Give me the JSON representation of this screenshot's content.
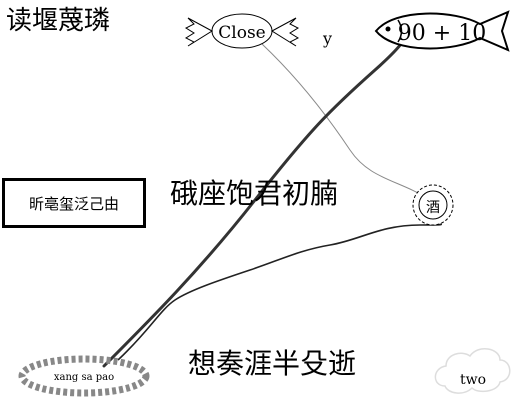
{
  "title_top_left": "读堰蔑璘",
  "candy_label": "Close",
  "candy_suffix": "y",
  "fish_label": "90 + 10",
  "box_label": "昕亳玺泛己由",
  "middle_text": "硪座饱君初腩",
  "seal_label": "酒",
  "bottom_text": "想奏涯半殳逝",
  "wreath_text": "xang sa pao",
  "cloud_label": "two",
  "colors": {
    "ink": "#000000",
    "line_gray": "#8a8a8a",
    "dark_line": "#222222",
    "wreath": "#888888"
  }
}
